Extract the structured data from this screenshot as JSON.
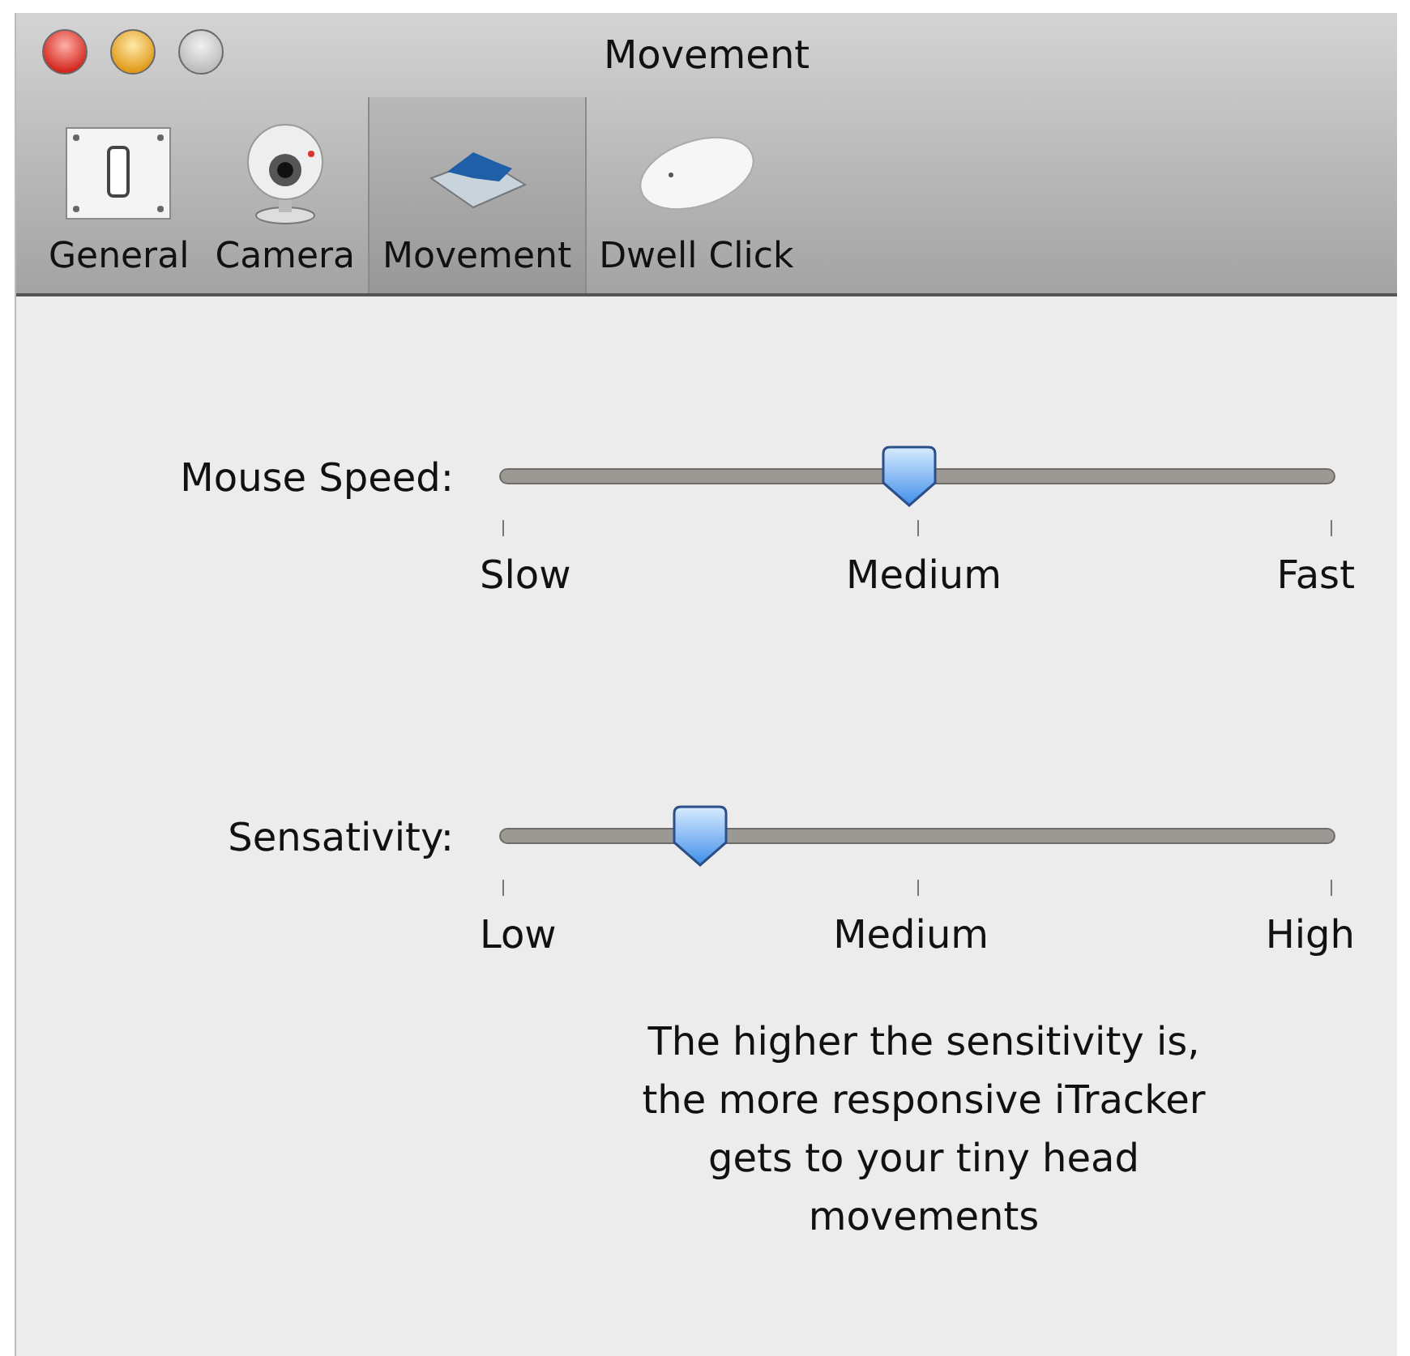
{
  "window": {
    "title": "Movement"
  },
  "toolbar": [
    {
      "label": "General",
      "kind": "switch",
      "selected": false
    },
    {
      "label": "Camera",
      "kind": "camera",
      "selected": false
    },
    {
      "label": "Movement",
      "kind": "movement",
      "selected": true
    },
    {
      "label": "Dwell Click",
      "kind": "mouse",
      "selected": false
    }
  ],
  "sliders": [
    {
      "label": "Mouse Speed:",
      "level": 0.49,
      "ticks": [
        "Slow",
        "Medium",
        "Fast"
      ]
    },
    {
      "label": "Sensativity:",
      "level": 0.24,
      "ticks": [
        "Low",
        "Medium",
        "High"
      ]
    }
  ],
  "description": "The higher the sensitivity is, the more responsive iTracker gets to your tiny head movements"
}
